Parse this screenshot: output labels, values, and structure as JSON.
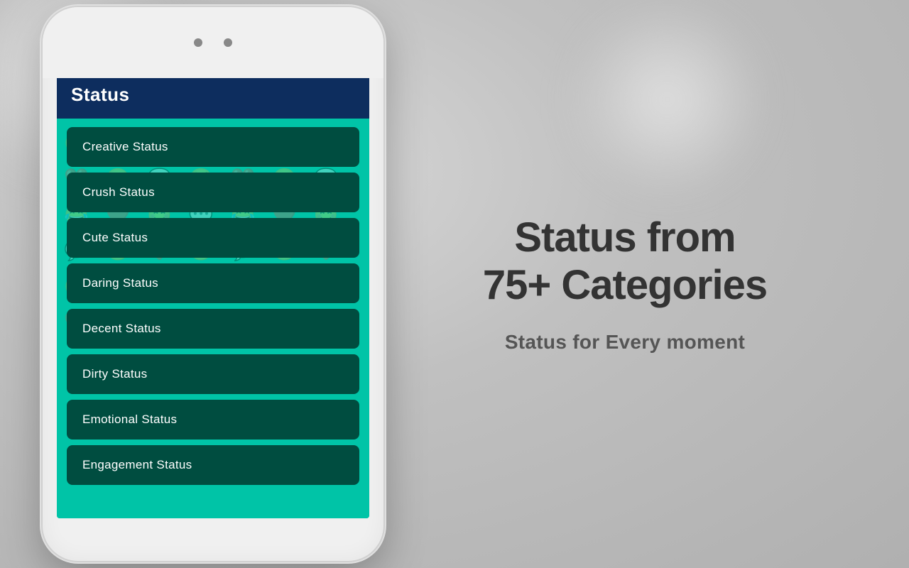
{
  "background": {
    "color_start": "#d8d8d8",
    "color_end": "#b0b0b0"
  },
  "phone": {
    "frame_color": "#f0f0f0"
  },
  "app": {
    "header_title": "Status",
    "header_bg": "#0d2d5e",
    "content_bg": "#00c4a7",
    "menu_item_bg": "#004d40",
    "menu_items": [
      {
        "id": "creative-status",
        "label": "Creative Status"
      },
      {
        "id": "crush-status",
        "label": "Crush Status"
      },
      {
        "id": "cute-status",
        "label": "Cute Status"
      },
      {
        "id": "daring-status",
        "label": "Daring Status"
      },
      {
        "id": "decent-status",
        "label": "Decent Status"
      },
      {
        "id": "dirty-status",
        "label": "Dirty Status"
      },
      {
        "id": "emotional-status",
        "label": "Emotional Status"
      },
      {
        "id": "engagement-status",
        "label": "Engagement Status"
      }
    ]
  },
  "right_panel": {
    "headline_line1": "Status from",
    "headline_line2": "75+ Categories",
    "subheadline": "Status for Every moment"
  }
}
